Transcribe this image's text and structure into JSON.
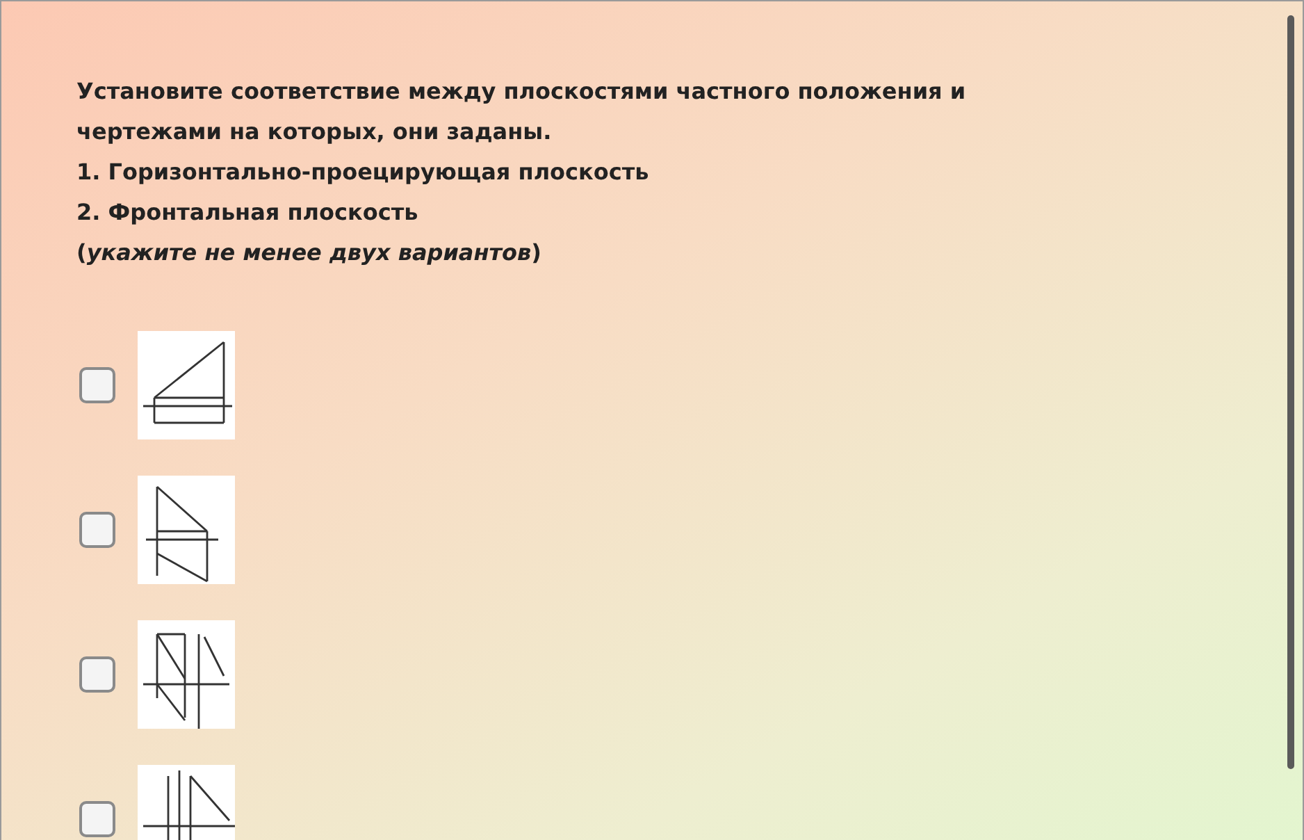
{
  "question": {
    "lines": [
      "Установите соответствие между плоскостями частного положения и",
      "чертежами на которых, они заданы.",
      "1. Горизонтально-проецирующая плоскость",
      "2. Фронтальная плоскость",
      "(*укажите не менее двух вариантов*)"
    ]
  },
  "options": [
    {
      "checked": false
    },
    {
      "checked": false
    },
    {
      "checked": false
    },
    {
      "checked": false
    }
  ]
}
